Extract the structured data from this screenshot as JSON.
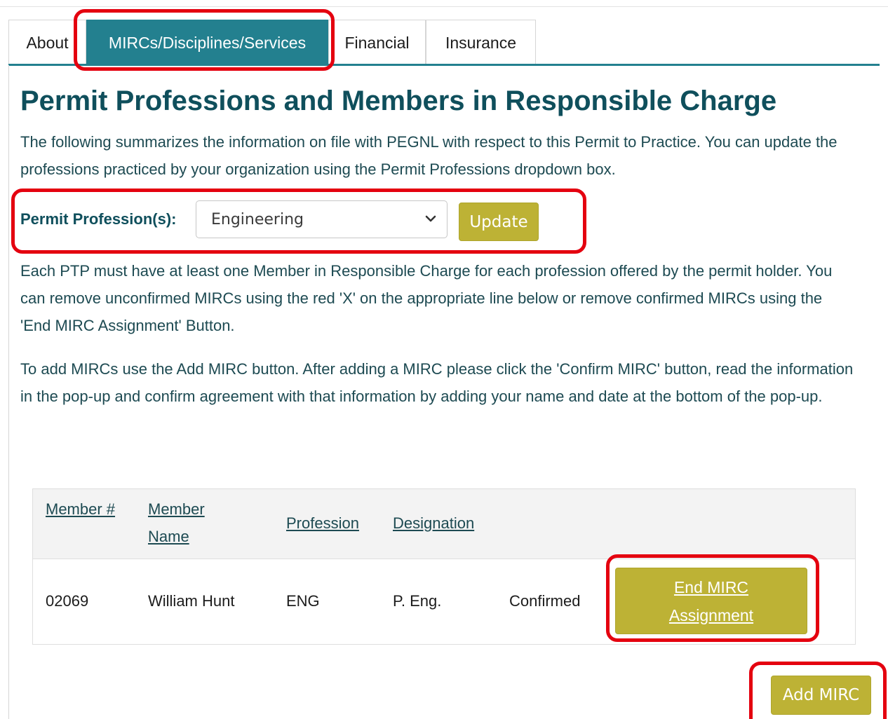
{
  "tabs": [
    {
      "label": "About"
    },
    {
      "label": "MIRCs/Disciplines/Services",
      "active": true
    },
    {
      "label": "Financial"
    },
    {
      "label": "Insurance"
    }
  ],
  "page": {
    "title": "Permit Professions and Members in Responsible Charge",
    "intro": "The following summarizes the information on file with PEGNL with respect to this Permit to Practice. You can update the professions practiced by your organization using the Permit Professions dropdown box.",
    "mirc_note": "Each PTP must have at least one Member in Responsible Charge for each profession offered by the permit holder. You can remove unconfirmed MIRCs using the red 'X' on the appropriate line below or remove confirmed MIRCs using the 'End MIRC Assignment' Button.",
    "add_note": "To  add MIRCs use the Add MIRC button. After adding a MIRC please click the 'Confirm MIRC' button, read the information in the pop-up and confirm agreement with that information by adding your name and date at the bottom of the pop-up."
  },
  "profession": {
    "label": "Permit Profession(s):",
    "selected": "Engineering",
    "update_label": "Update",
    "icon": "chevron-down-icon"
  },
  "table": {
    "headers": {
      "member_no": "Member #",
      "member_name": "Member Name",
      "profession": "Profession",
      "designation": "Designation"
    },
    "rows": [
      {
        "member_no": "02069",
        "member_name": "William Hunt",
        "profession": "ENG",
        "designation": "P. Eng.",
        "status": "Confirmed",
        "action_label": "End MIRC Assignment"
      }
    ]
  },
  "add_mirc_label": "Add MIRC",
  "colors": {
    "accent_teal": "#23808f",
    "title_teal": "#0f4f5c",
    "button_olive": "#bdb235",
    "highlight_red": "#e4000f"
  }
}
